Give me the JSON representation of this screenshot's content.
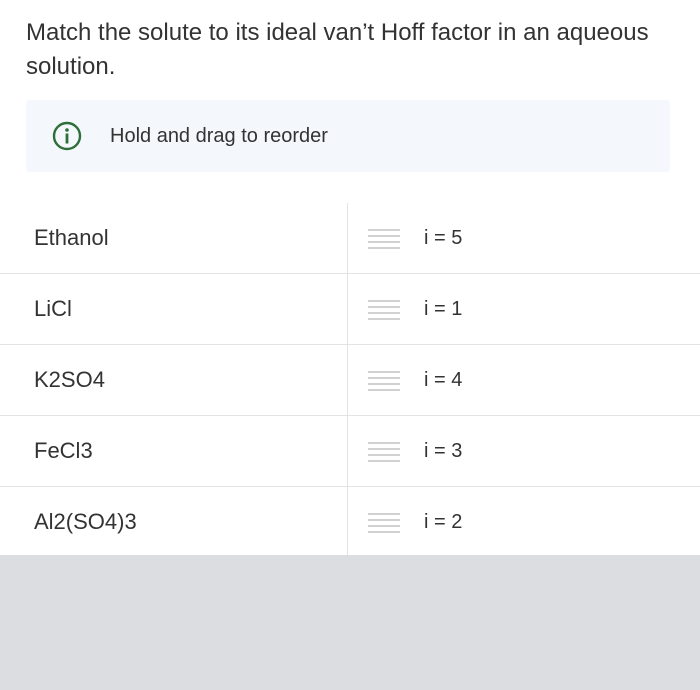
{
  "question": {
    "text": "Match the solute to its ideal van’t Hoff factor in an aqueous solution."
  },
  "info": {
    "icon": "info-icon",
    "text": "Hold and drag to reorder"
  },
  "rows": [
    {
      "solute": "Ethanol",
      "factor": "i = 5"
    },
    {
      "solute": "LiCl",
      "factor": "i = 1"
    },
    {
      "solute": "K2SO4",
      "factor": "i = 4"
    },
    {
      "solute": "FeCl3",
      "factor": "i = 3"
    },
    {
      "solute": "Al2(SO4)3",
      "factor": "i = 2"
    }
  ],
  "colors": {
    "accent_icon": "#2e6e38",
    "info_bg": "#f4f8fc",
    "footer_bg": "#dcdde1"
  }
}
